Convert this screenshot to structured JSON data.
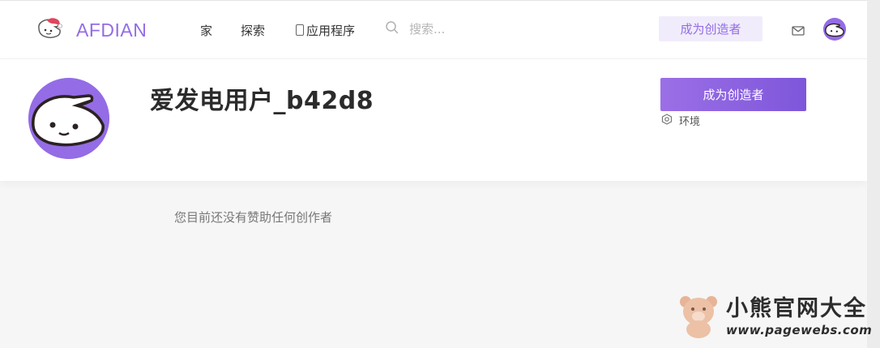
{
  "header": {
    "logo_text": "AFDIAN",
    "nav": {
      "home": "家",
      "explore": "探索",
      "app": "应用程序"
    },
    "search": {
      "placeholder": "搜索..."
    },
    "become_creator": "成为创造者"
  },
  "profile": {
    "username": "爱发电用户_b42d8",
    "become_creator": "成为创造者",
    "environment": "环境"
  },
  "main": {
    "empty_message": "您目前还没有赞助任何创作者"
  },
  "watermark": {
    "title": "小熊官网大全",
    "url": "www.pagewebs.com"
  },
  "colors": {
    "brand": "#946ce6",
    "brand_light": "#f1ecfb",
    "background": "#f6f6f6"
  },
  "icons": {
    "logo": "afdian-logo-icon",
    "search": "search-icon",
    "phone": "phone-icon",
    "mail": "mail-icon",
    "settings": "hexagon-gear-icon",
    "avatar": "user-avatar"
  }
}
